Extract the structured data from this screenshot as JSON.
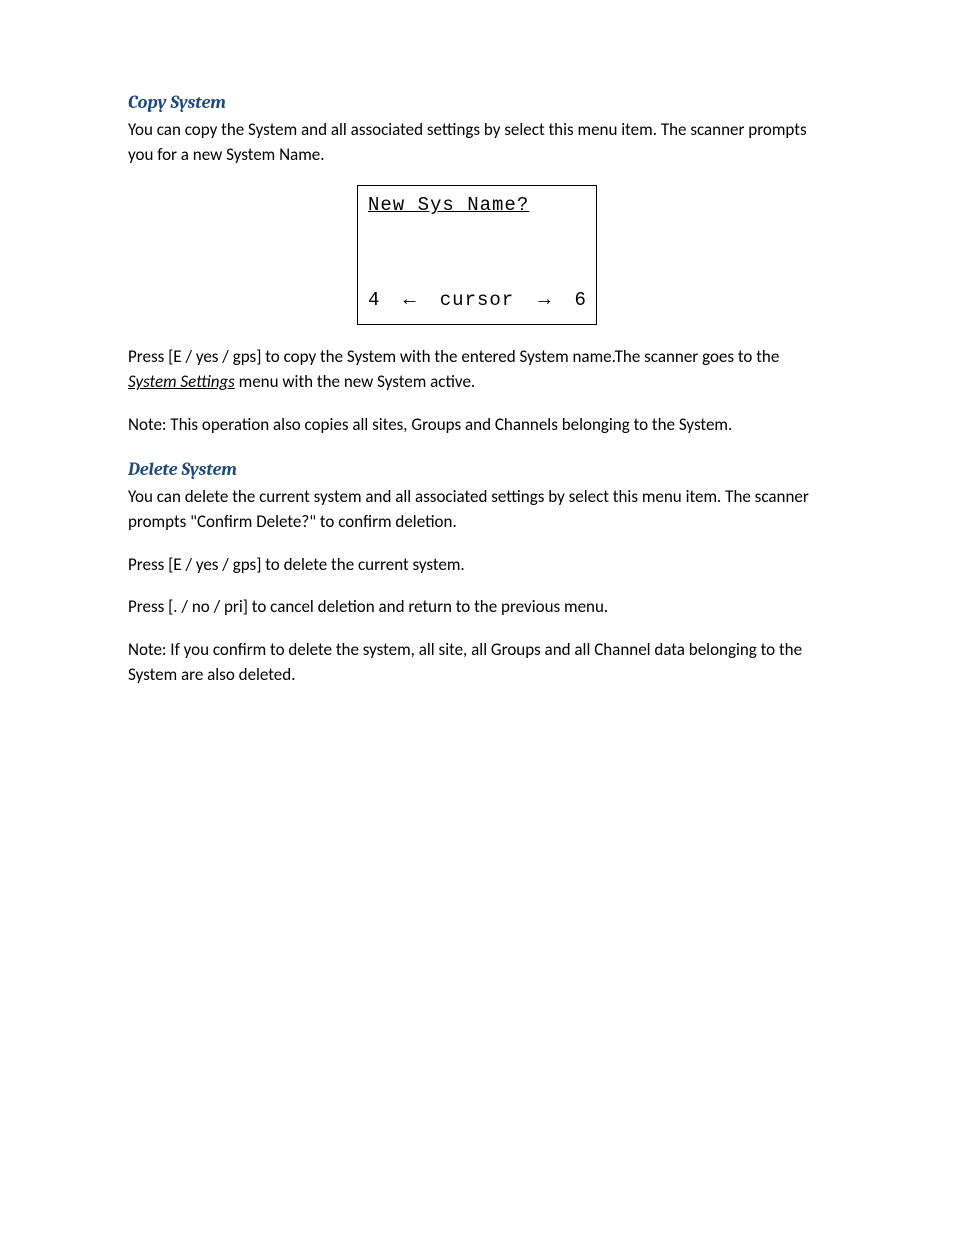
{
  "copy_section": {
    "heading": "Copy System",
    "para1": "You can copy the System and all associated settings by select this menu item. The scanner prompts you for a new System Name.",
    "display": {
      "title": "New Sys Name?",
      "left_num": "4",
      "cursor_label": "cursor",
      "right_num": "6"
    },
    "para2_a": "Press [E / yes / gps] to copy the System with the entered System name.The scanner goes to the ",
    "para2_link": "System Settings",
    "para2_b": " menu with the new System active.",
    "para3": "Note: This operation also copies  all sites, Groups and Channels belonging  to the System."
  },
  "delete_section": {
    "heading": "Delete System",
    "para1": "You can delete the current system and all associated settings by select this menu item. The scanner prompts \"Confirm Delete?\" to confirm deletion.",
    "para2": "Press [E / yes / gps] to delete the current system.",
    "para3": "Press [. / no / pri] to cancel deletion and return to the previous menu.",
    "para4": "Note: If you confirm to delete the system, all site, all Groups and all Channel data belonging to the System are also deleted."
  }
}
